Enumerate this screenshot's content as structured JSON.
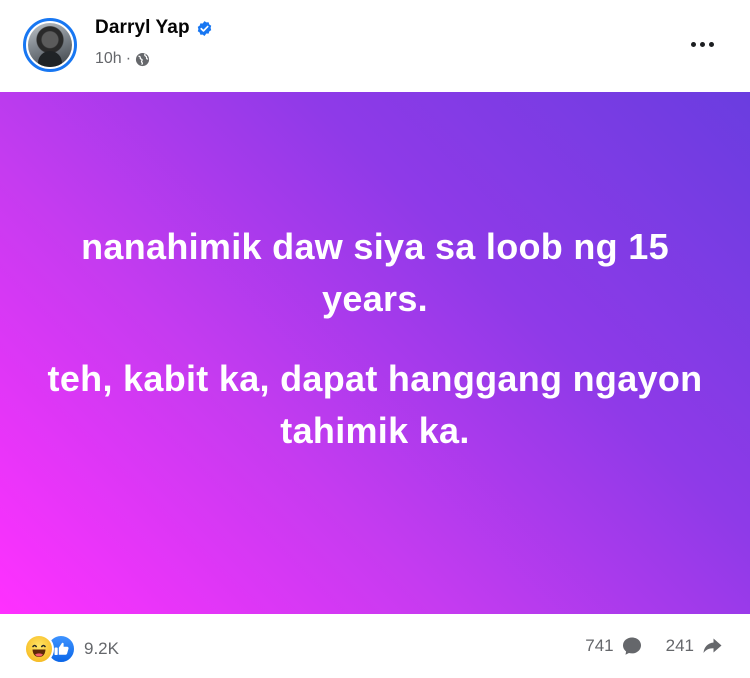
{
  "post": {
    "author": {
      "name": "Darryl Yap",
      "verified": true
    },
    "time": "10h",
    "separator": "·",
    "audience_icon": "globe-icon",
    "more_icon": "more-options-icon"
  },
  "status": {
    "paragraph_1": "nanahimik daw siya sa loob ng 15 years.",
    "paragraph_2": "teh, kabit ka, dapat hanggang ngayon tahimik ka.",
    "gradient_colors": [
      "#ff30ff",
      "#c63bf0",
      "#8f3ae8",
      "#6a3de0"
    ],
    "text_color": "#ffffff"
  },
  "footer": {
    "reactions": [
      "haha-icon",
      "like-icon"
    ],
    "reaction_count": "9.2K",
    "comment_count": "741",
    "share_count": "241"
  },
  "colors": {
    "verified_blue": "#1877f2",
    "meta_gray": "#65676b",
    "text_dark": "#050505"
  }
}
